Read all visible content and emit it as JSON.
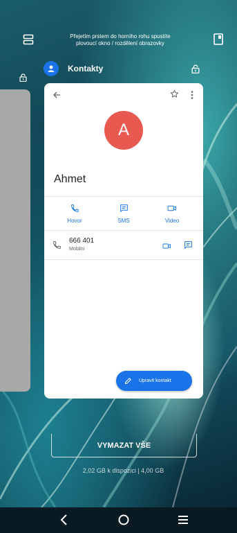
{
  "hint": {
    "line1": "Přejetím prstem do horního rohu spustíte",
    "line2": "plovoucí okno / rozdělení obrazovky"
  },
  "app": {
    "name": "Kontakty",
    "accent": "#1a73e8"
  },
  "contact": {
    "avatar_letter": "A",
    "avatar_color": "#e85a4f",
    "name": "Ahmet",
    "actions": [
      {
        "label": "Hovor",
        "icon": "phone-icon"
      },
      {
        "label": "SMS",
        "icon": "message-icon"
      },
      {
        "label": "Video",
        "icon": "video-icon"
      }
    ],
    "phone": {
      "number": "666 401",
      "type": "Mobilní"
    },
    "edit_label": "Upravit kontakt"
  },
  "recents": {
    "clear_all": "VYMAZAT VŠE",
    "memory": "2,02 GB k dispozici | 4,00 GB"
  },
  "navigation": [
    "back-icon",
    "home-icon",
    "menu-icon"
  ]
}
